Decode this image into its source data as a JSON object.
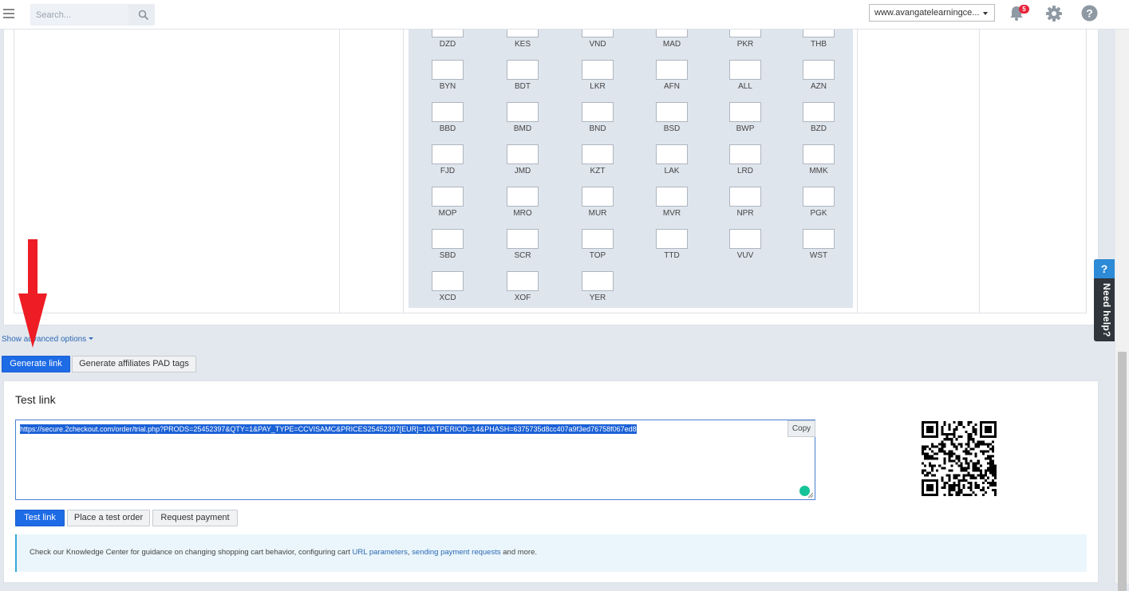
{
  "header": {
    "search_placeholder": "Search...",
    "site_selector_value": "www.avangatelearningce...",
    "notification_count": "5",
    "icons": [
      "menu-icon",
      "search-icon",
      "bell-icon",
      "gear-icon",
      "help-icon"
    ]
  },
  "currencies": [
    [
      "DZD",
      "KES",
      "VND",
      "MAD",
      "PKR",
      "THB"
    ],
    [
      "BYN",
      "BDT",
      "LKR",
      "AFN",
      "ALL",
      "AZN"
    ],
    [
      "BBD",
      "BMD",
      "BND",
      "BSD",
      "BWP",
      "BZD"
    ],
    [
      "FJD",
      "JMD",
      "KZT",
      "LAK",
      "LRD",
      "MMK"
    ],
    [
      "MOP",
      "MRO",
      "MUR",
      "MVR",
      "NPR",
      "PGK"
    ],
    [
      "SBD",
      "SCR",
      "TOP",
      "TTD",
      "VUV",
      "WST"
    ],
    [
      "XCD",
      "XOF",
      "YER"
    ]
  ],
  "actions": {
    "show_advanced_options": "Show advanced options",
    "generate_link": "Generate link",
    "generate_affiliates_pad_tags": "Generate affiliates PAD tags"
  },
  "test_link": {
    "title": "Test link",
    "url": "https://secure.2checkout.com/order/trial.php?PRODS=25452397&QTY=1&PAY_TYPE=CCVISAMC&PRICES25452397[EUR]=10&TPERIOD=14&PHASH=6375735d8cc407a9f3ed76758f067ed8",
    "copy_label": "Copy",
    "buttons": {
      "test_link": "Test link",
      "place_test_order": "Place a test order",
      "request_payment": "Request payment"
    }
  },
  "knowledge_center": {
    "text_before": "Check our Knowledge Center for guidance on changing shopping cart behavior, configuring cart ",
    "link_url_parameters": "URL parameters",
    "separator": ", ",
    "link_payment_requests": "sending payment requests",
    "text_after": " and more."
  },
  "need_help": {
    "icon": "?",
    "label": "Need help?"
  },
  "colors": {
    "primary": "#1e6be6",
    "link": "#2d68b3",
    "annotation_arrow": "#ee1c24",
    "badge": "#e5263b",
    "need_help_bg": "#2f353b"
  }
}
